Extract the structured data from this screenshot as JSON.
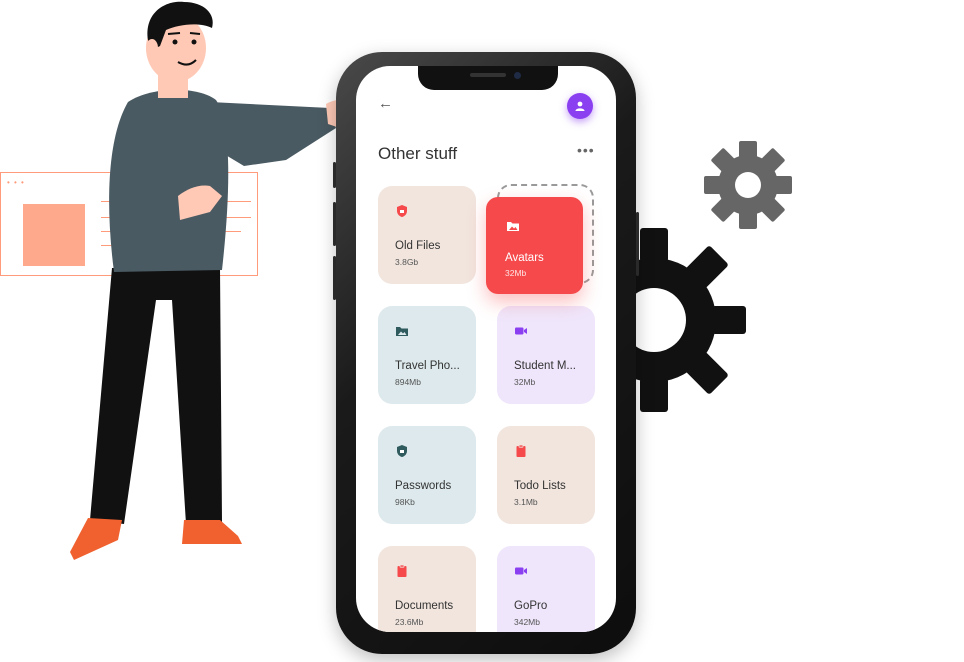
{
  "screen": {
    "title": "Other stuff",
    "back_icon": "arrow-left-icon",
    "more_icon": "more-horizontal-icon",
    "avatar_icon": "user-icon"
  },
  "dragging_card": {
    "name": "Avatars",
    "size": "32Mb",
    "icon": "folder-image-icon",
    "color": "#f5494b"
  },
  "cards": [
    {
      "name": "Old Files",
      "size": "3.8Gb",
      "icon": "shield-icon",
      "bg": "#f1e5de",
      "icon_color": "#f5494b"
    },
    {
      "name": "Travel Pho...",
      "size": "894Mb",
      "icon": "folder-image-icon",
      "bg": "#dde9ec",
      "icon_color": "#2f5a5e"
    },
    {
      "name": "Student M...",
      "size": "32Mb",
      "icon": "video-icon",
      "bg": "#efe6fb",
      "icon_color": "#8a3ff0"
    },
    {
      "name": "Passwords",
      "size": "98Kb",
      "icon": "shield-icon",
      "bg": "#dde9ec",
      "icon_color": "#2f5a5e"
    },
    {
      "name": "Todo Lists",
      "size": "3.1Mb",
      "icon": "clipboard-icon",
      "bg": "#f1e5de",
      "icon_color": "#f5494b"
    },
    {
      "name": "Documents",
      "size": "23.6Mb",
      "icon": "clipboard-icon",
      "bg": "#f1e5de",
      "icon_color": "#f5494b"
    },
    {
      "name": "GoPro",
      "size": "342Mb",
      "icon": "video-icon",
      "bg": "#efe6fb",
      "icon_color": "#8a3ff0"
    }
  ],
  "colors": {
    "accent_purple": "#8a3ff0",
    "accent_red": "#f5494b",
    "illustration_orange": "#ff9a7a",
    "gear_dark": "#111111",
    "gear_grey": "#666666"
  }
}
